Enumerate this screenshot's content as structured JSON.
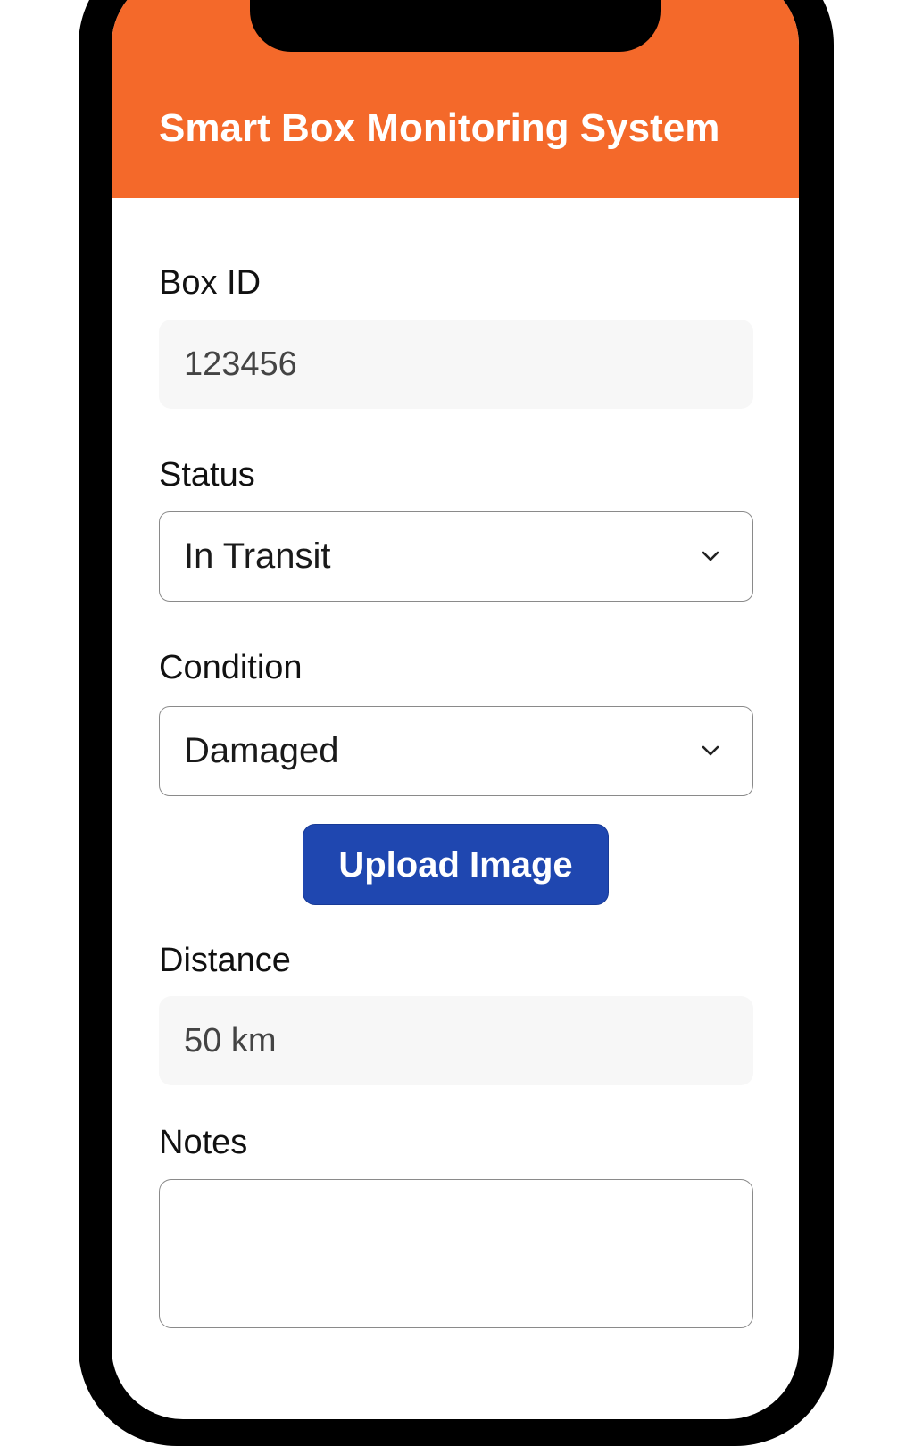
{
  "app": {
    "title": "Smart Box Monitoring System",
    "accent_color": "#f4692a",
    "button_color": "#1f47b0"
  },
  "form": {
    "box_id": {
      "label": "Box ID",
      "value": "123456"
    },
    "status": {
      "label": "Status",
      "selected": "In Transit",
      "icon": "chevron-down-icon"
    },
    "condition": {
      "label": "Condition",
      "selected": "Damaged",
      "icon": "chevron-down-icon"
    },
    "upload_button": {
      "label": "Upload Image"
    },
    "distance": {
      "label": "Distance",
      "value": "50 km"
    },
    "notes": {
      "label": "Notes",
      "value": ""
    }
  }
}
